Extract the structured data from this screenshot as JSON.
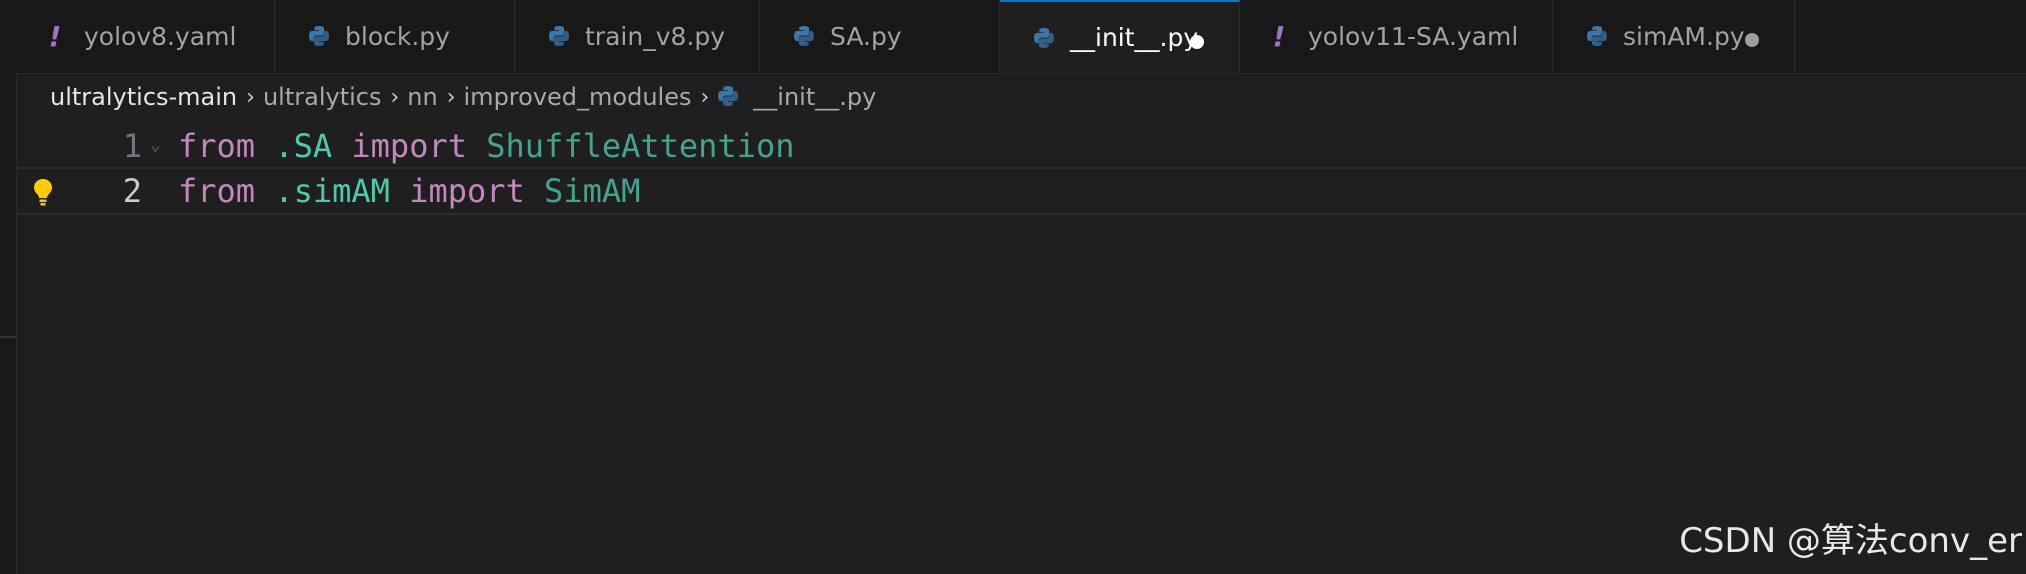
{
  "tabs": [
    {
      "label": "yolov8.yaml",
      "icon": "yaml-exclamation-icon",
      "active": false,
      "modified": false
    },
    {
      "label": "block.py",
      "icon": "python-icon",
      "active": false,
      "modified": false
    },
    {
      "label": "train_v8.py",
      "icon": "python-icon",
      "active": false,
      "modified": false
    },
    {
      "label": "SA.py",
      "icon": "python-icon",
      "active": false,
      "modified": false
    },
    {
      "label": "__init__.py",
      "icon": "python-icon",
      "active": true,
      "modified": true
    },
    {
      "label": "yolov11-SA.yaml",
      "icon": "yaml-exclamation-icon",
      "active": false,
      "modified": false
    },
    {
      "label": "simAM.py",
      "icon": "python-icon",
      "active": false,
      "modified": true
    }
  ],
  "breadcrumb": {
    "items": [
      "ultralytics-main",
      "ultralytics",
      "nn",
      "improved_modules",
      "__init__.py"
    ]
  },
  "code": {
    "lines": [
      {
        "number": "1",
        "kw1": "from",
        "module": ".SA",
        "kw2": "import",
        "name": "ShuffleAttention"
      },
      {
        "number": "2",
        "kw1": "from",
        "module": ".simAM",
        "kw2": "import",
        "name": "SimAM"
      }
    ]
  },
  "watermark": "CSDN @算法conv_er",
  "colors": {
    "accent": "#0078d4",
    "keyword": "#c586c0",
    "module": "#4ec9b0",
    "yaml_icon": "#a074c4",
    "python_icon_blue": "#3b77a8",
    "python_icon_yellow": "#ffd43b"
  }
}
